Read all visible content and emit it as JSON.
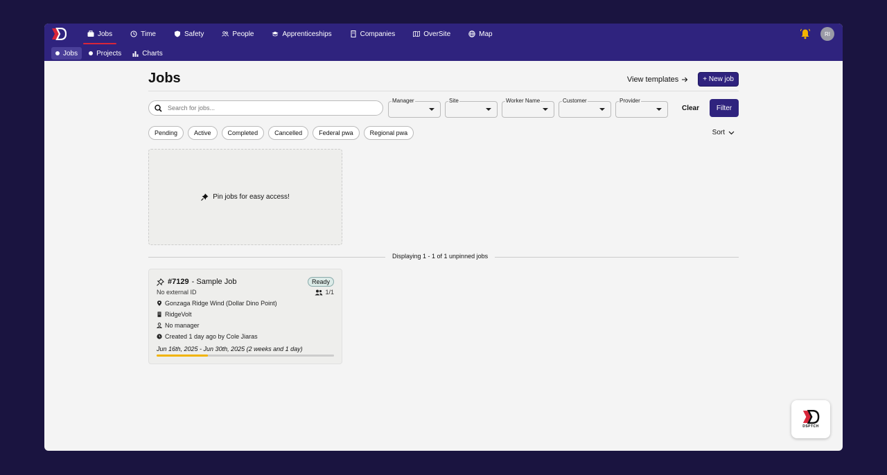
{
  "nav": {
    "main": [
      {
        "label": "Jobs",
        "icon": "briefcase-icon"
      },
      {
        "label": "Time",
        "icon": "clock-icon"
      },
      {
        "label": "Safety",
        "icon": "shield-icon"
      },
      {
        "label": "People",
        "icon": "people-icon"
      },
      {
        "label": "Apprenticeships",
        "icon": "graduation-cap-icon"
      },
      {
        "label": "Companies",
        "icon": "building-icon"
      },
      {
        "label": "OverSite",
        "icon": "map-icon"
      },
      {
        "label": "Map",
        "icon": "globe-icon"
      }
    ],
    "sub": [
      {
        "label": "Jobs",
        "icon": "dot-icon"
      },
      {
        "label": "Projects",
        "icon": "dot-icon"
      },
      {
        "label": "Charts",
        "icon": "bar-chart-icon"
      }
    ],
    "avatar_initials": "RI"
  },
  "page": {
    "title": "Jobs",
    "view_templates": "View templates",
    "new_job": "+ New job"
  },
  "filters": {
    "search_placeholder": "Search for jobs...",
    "manager_label": "Manager",
    "site_label": "Site",
    "worker_label": "Worker Name",
    "customer_label": "Customer",
    "provider_label": "Provider",
    "clear": "Clear",
    "filter": "Filter",
    "chips": [
      "Pending",
      "Active",
      "Completed",
      "Cancelled",
      "Federal pwa",
      "Regional pwa"
    ],
    "sort": "Sort"
  },
  "pin_message": "Pin jobs for easy access!",
  "displaying": "Displaying 1 - 1 of 1 unpinned jobs",
  "job": {
    "number": "#7129",
    "name": " - Sample Job",
    "status": "Ready",
    "external_id": "No external ID",
    "workers": "1/1",
    "site": "Gonzaga Ridge Wind (Dollar Dino Point)",
    "company": "RidgeVolt",
    "manager": "No manager",
    "created": "Created 1 day ago by Cole Jiaras",
    "date_range": "Jun 16th, 2025 - Jun 30th, 2025 (2 weeks and 1 day)",
    "progress_fraction": 0.29
  },
  "colors": {
    "nav_bg": "#2f237e",
    "accent_red": "#d8263a",
    "progress": "#f2b400",
    "bell": "#f2b400"
  },
  "widget_brand": "DSPTCH"
}
